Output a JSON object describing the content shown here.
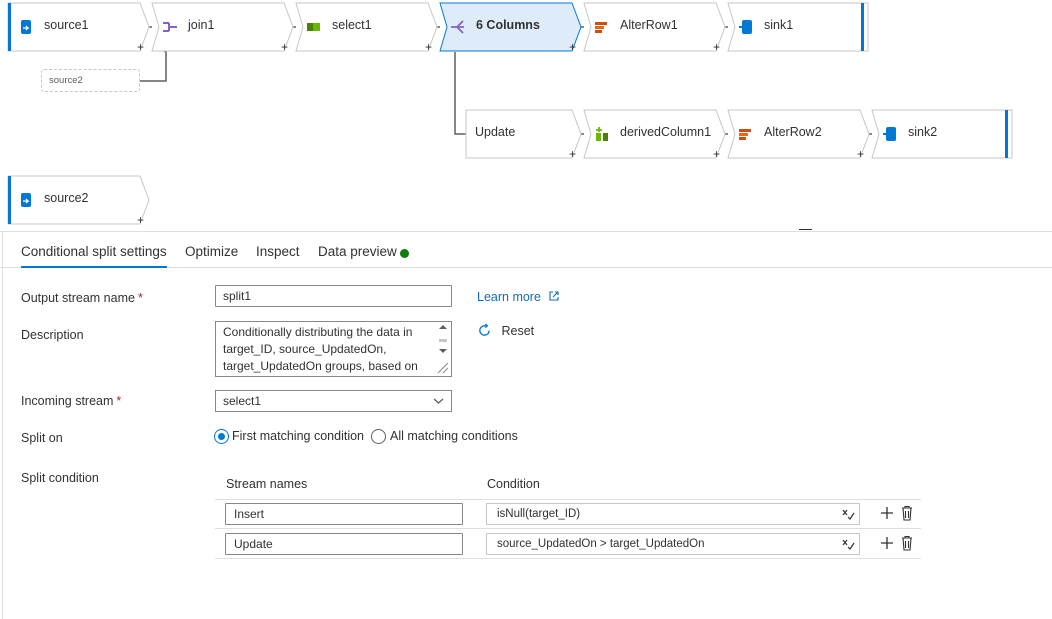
{
  "canvas": {
    "nodes": {
      "source1": "source1",
      "join1": "join1",
      "select1": "select1",
      "split": "6 Columns",
      "alterrow1": "AlterRow1",
      "sink1": "sink1",
      "update": "Update",
      "derived": "derivedColumn1",
      "alterrow2": "AlterRow2",
      "sink2": "sink2",
      "source2": "source2"
    },
    "source2_ref": "source2",
    "plus": "+",
    "colors": {
      "node_border": "#c8c6c4",
      "selected_fill": "#deecf9",
      "selected_border": "#0078d4",
      "source_bar": "#0078d4",
      "connector": "#605e5c"
    },
    "icons": {
      "source": "database-arrow-icon",
      "join": "join-icon",
      "select": "select-icon",
      "split": "split-icon",
      "alterrow": "alter-row-icon",
      "sink": "sink-database-icon",
      "derived": "derived-column-icon"
    }
  },
  "tabs": {
    "settings": "Conditional split settings",
    "optimize": "Optimize",
    "inspect": "Inspect",
    "preview": "Data preview"
  },
  "form": {
    "output_stream_label": "Output stream name",
    "required_mark": "*",
    "output_stream_value": "split1",
    "learn_more": "Learn more",
    "description_label": "Description",
    "description_value": "Conditionally distributing the data in target_ID, source_UpdatedOn, target_UpdatedOn groups, based on",
    "reset": "Reset",
    "incoming_label": "Incoming stream",
    "incoming_value": "select1",
    "split_on_label": "Split on",
    "split_first": "First matching condition",
    "split_all": "All matching conditions",
    "split_first_selected": true,
    "split_condition_label": "Split condition"
  },
  "conditions": {
    "header_stream": "Stream names",
    "header_condition": "Condition",
    "rows": [
      {
        "stream": "Insert",
        "condition": "isNull(target_ID)"
      },
      {
        "stream": "Update",
        "condition": "source_UpdatedOn > target_UpdatedOn"
      }
    ]
  }
}
